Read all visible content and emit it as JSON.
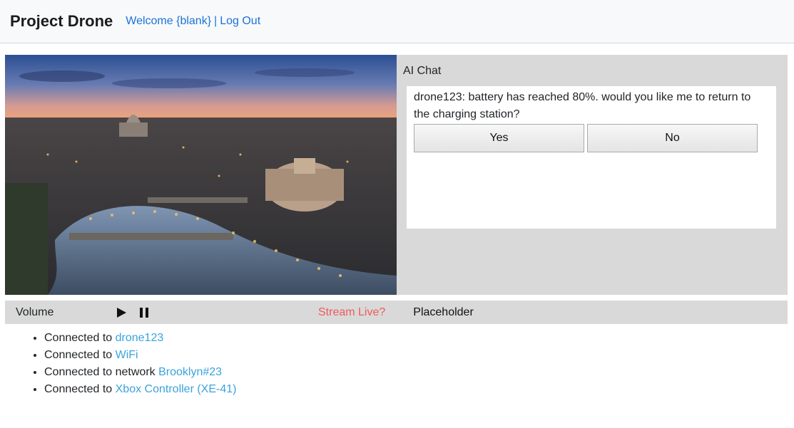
{
  "header": {
    "brand": "Project Drone",
    "welcome_link": "Welcome {blank}",
    "separator": "|",
    "logout_link": "Log Out"
  },
  "chat": {
    "title": "AI Chat",
    "message": "drone123: battery has reached 80%. would you like me to return to the charging station?",
    "yes_label": "Yes",
    "no_label": "No"
  },
  "controls": {
    "volume_label": "Volume",
    "play_icon": "play-icon",
    "pause_icon": "pause-icon",
    "stream_label": "Stream Live?",
    "placeholder_label": "Placeholder"
  },
  "status": [
    {
      "prefix": "Connected to ",
      "value": "drone123"
    },
    {
      "prefix": "Connected to ",
      "value": "WiFi"
    },
    {
      "prefix": "Connected to network ",
      "value": "Brooklyn#23"
    },
    {
      "prefix": "Connected to ",
      "value": "Xbox Controller (XE-41)"
    }
  ],
  "colors": {
    "link": "#1a73d9",
    "status_value": "#3aa3dc",
    "stream_live": "#f05a5a",
    "panel_bg": "#d9d9d9"
  }
}
